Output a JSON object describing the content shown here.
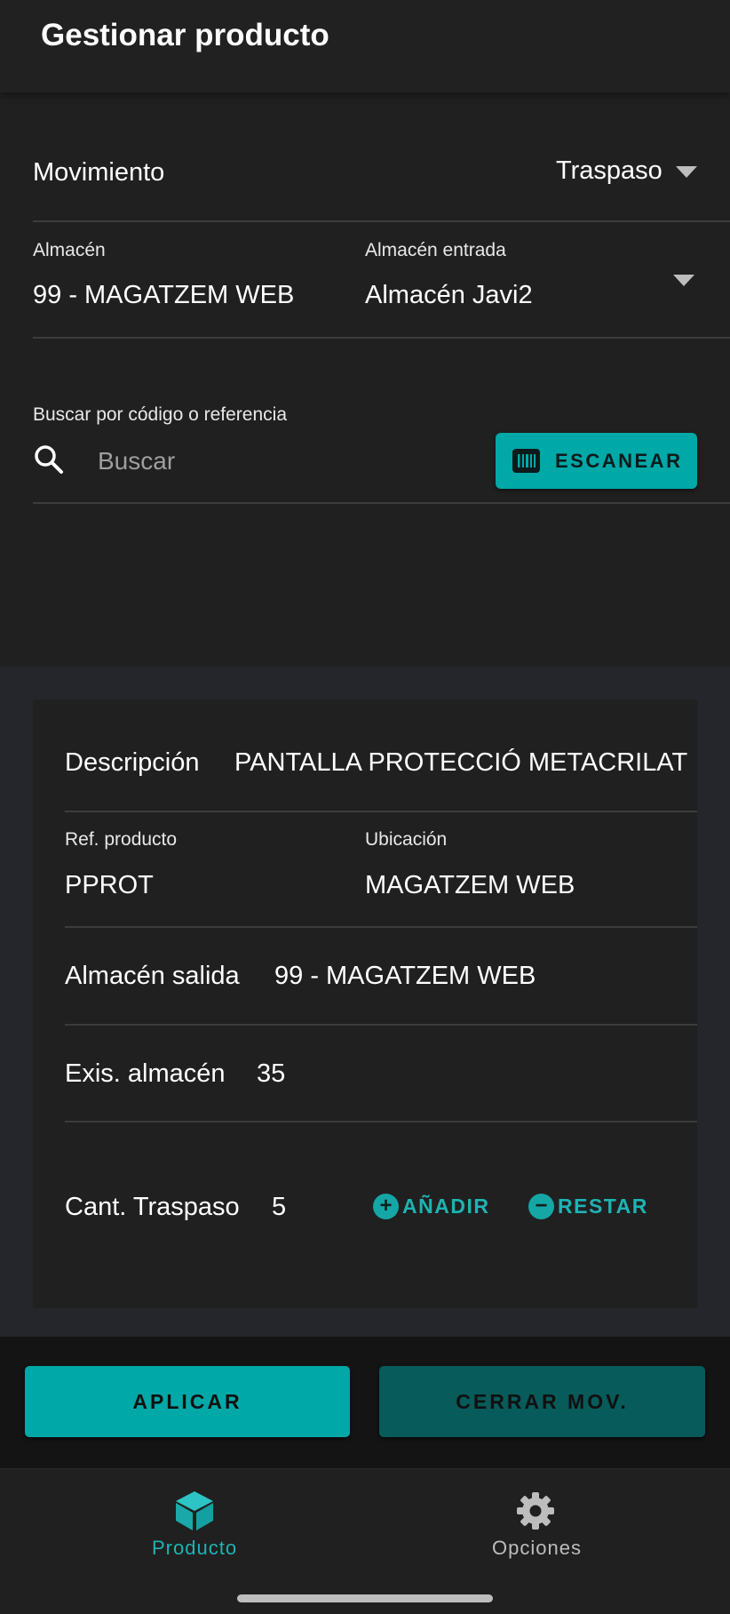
{
  "header": {
    "title": "Gestionar producto"
  },
  "movement": {
    "label": "Movimiento",
    "value": "Traspaso"
  },
  "warehouse": {
    "label": "Almacén",
    "value": "99 - MAGATZEM WEB",
    "entry_label": "Almacén entrada",
    "entry_value": "Almacén Javi2"
  },
  "search": {
    "label": "Buscar por código o referencia",
    "placeholder": "Buscar",
    "scan_label": "ESCANEAR"
  },
  "product": {
    "description_label": "Descripción",
    "description_value": "PANTALLA PROTECCIÓ METACRILAT",
    "ref_label": "Ref. producto",
    "ref_value": "PPROT",
    "location_label": "Ubicación",
    "location_value": "MAGATZEM WEB",
    "out_warehouse_label": "Almacén salida",
    "out_warehouse_value": "99 - MAGATZEM WEB",
    "stock_label": "Exis. almacén",
    "stock_value": "35",
    "qty_label": "Cant. Traspaso",
    "qty_value": "5",
    "add_label": "AÑADIR",
    "subtract_label": "RESTAR"
  },
  "actions": {
    "apply_label": "APLICAR",
    "close_label": "CERRAR MOV."
  },
  "nav": {
    "items": [
      {
        "label": "Producto",
        "icon": "cube-icon",
        "active": true
      },
      {
        "label": "Opciones",
        "icon": "gear-icon",
        "active": false
      }
    ]
  },
  "colors": {
    "accent": "#00a8a8",
    "accent_dark": "#075b5b",
    "background": "#202020",
    "nav_active": "#1fb3b3",
    "nav_inactive": "#bdbdbd"
  }
}
